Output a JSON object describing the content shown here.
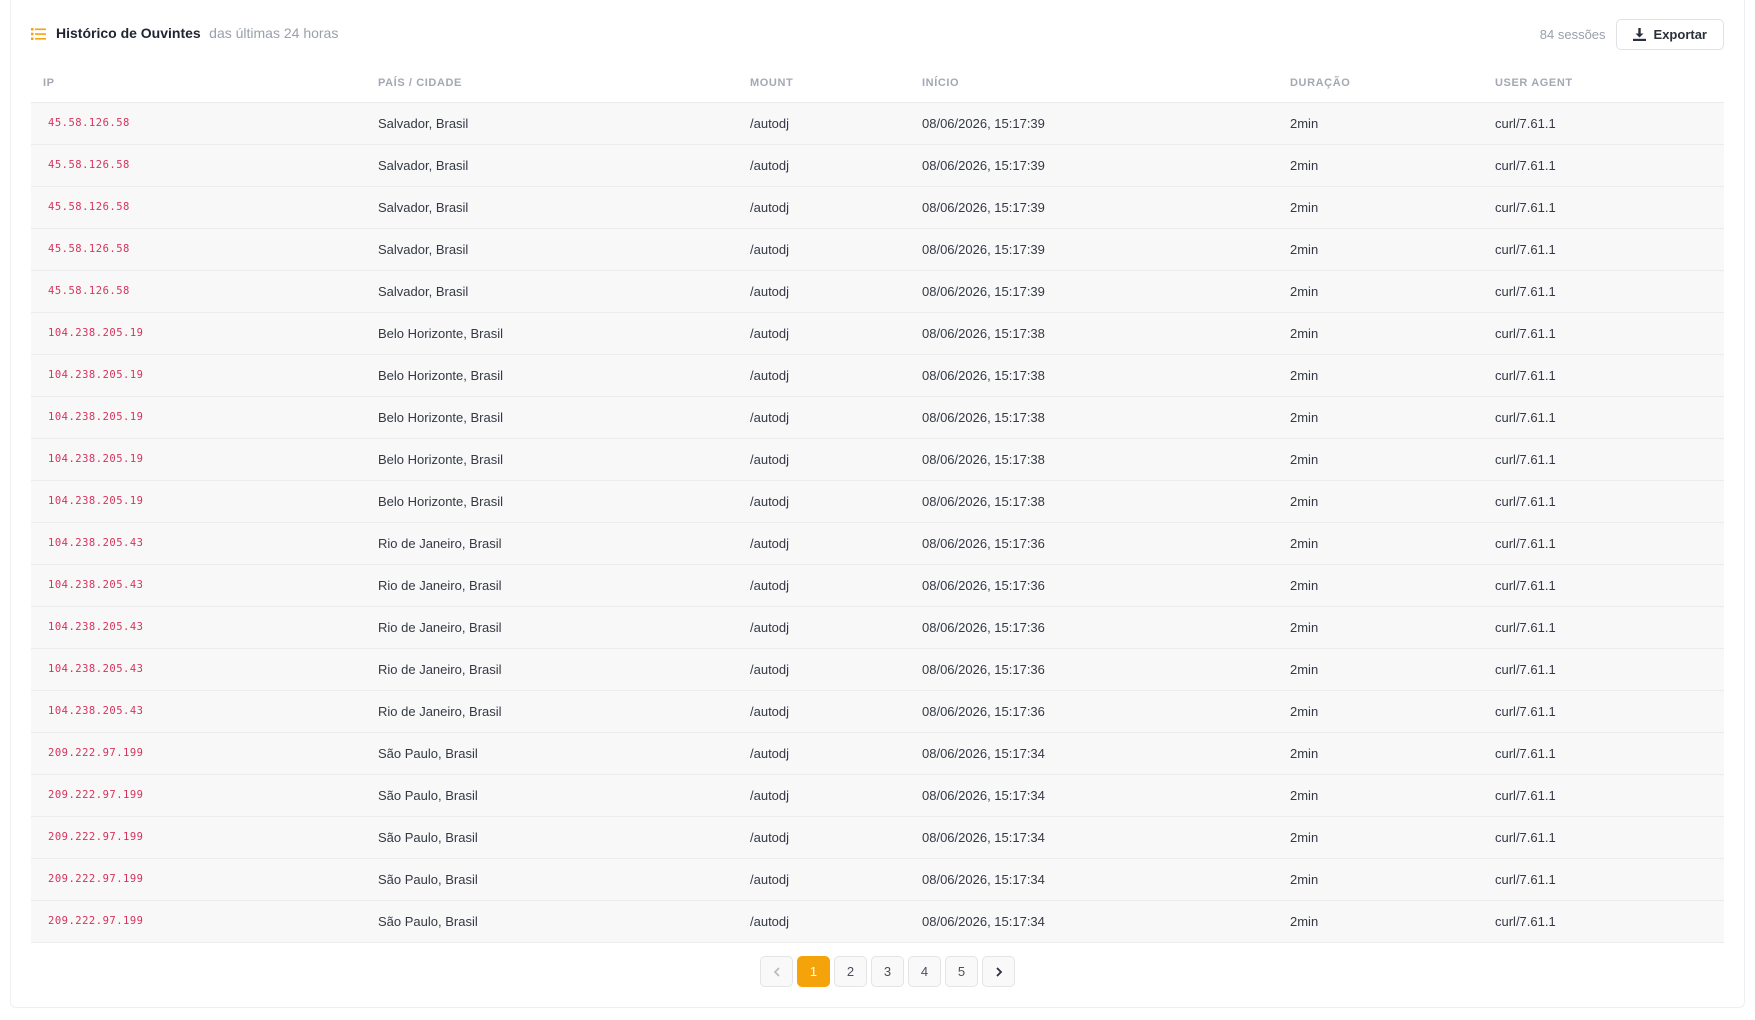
{
  "header": {
    "title": "Histórico de Ouvintes",
    "subtitle": "das últimas 24 horas",
    "count": "84 sessões",
    "export_label": "Exportar"
  },
  "colors": {
    "accent": "#f5a30a",
    "ip_text": "#d6335c"
  },
  "table": {
    "columns": [
      "IP",
      "PAÍS / CIDADE",
      "MOUNT",
      "INÍCIO",
      "DURAÇÃO",
      "USER AGENT"
    ],
    "rows": [
      [
        "45.58.126.58",
        "Salvador, Brasil",
        "/autodj",
        "08/06/2026, 15:17:39",
        "2min",
        "curl/7.61.1"
      ],
      [
        "45.58.126.58",
        "Salvador, Brasil",
        "/autodj",
        "08/06/2026, 15:17:39",
        "2min",
        "curl/7.61.1"
      ],
      [
        "45.58.126.58",
        "Salvador, Brasil",
        "/autodj",
        "08/06/2026, 15:17:39",
        "2min",
        "curl/7.61.1"
      ],
      [
        "45.58.126.58",
        "Salvador, Brasil",
        "/autodj",
        "08/06/2026, 15:17:39",
        "2min",
        "curl/7.61.1"
      ],
      [
        "45.58.126.58",
        "Salvador, Brasil",
        "/autodj",
        "08/06/2026, 15:17:39",
        "2min",
        "curl/7.61.1"
      ],
      [
        "104.238.205.19",
        "Belo Horizonte, Brasil",
        "/autodj",
        "08/06/2026, 15:17:38",
        "2min",
        "curl/7.61.1"
      ],
      [
        "104.238.205.19",
        "Belo Horizonte, Brasil",
        "/autodj",
        "08/06/2026, 15:17:38",
        "2min",
        "curl/7.61.1"
      ],
      [
        "104.238.205.19",
        "Belo Horizonte, Brasil",
        "/autodj",
        "08/06/2026, 15:17:38",
        "2min",
        "curl/7.61.1"
      ],
      [
        "104.238.205.19",
        "Belo Horizonte, Brasil",
        "/autodj",
        "08/06/2026, 15:17:38",
        "2min",
        "curl/7.61.1"
      ],
      [
        "104.238.205.19",
        "Belo Horizonte, Brasil",
        "/autodj",
        "08/06/2026, 15:17:38",
        "2min",
        "curl/7.61.1"
      ],
      [
        "104.238.205.43",
        "Rio de Janeiro, Brasil",
        "/autodj",
        "08/06/2026, 15:17:36",
        "2min",
        "curl/7.61.1"
      ],
      [
        "104.238.205.43",
        "Rio de Janeiro, Brasil",
        "/autodj",
        "08/06/2026, 15:17:36",
        "2min",
        "curl/7.61.1"
      ],
      [
        "104.238.205.43",
        "Rio de Janeiro, Brasil",
        "/autodj",
        "08/06/2026, 15:17:36",
        "2min",
        "curl/7.61.1"
      ],
      [
        "104.238.205.43",
        "Rio de Janeiro, Brasil",
        "/autodj",
        "08/06/2026, 15:17:36",
        "2min",
        "curl/7.61.1"
      ],
      [
        "104.238.205.43",
        "Rio de Janeiro, Brasil",
        "/autodj",
        "08/06/2026, 15:17:36",
        "2min",
        "curl/7.61.1"
      ],
      [
        "209.222.97.199",
        "São Paulo, Brasil",
        "/autodj",
        "08/06/2026, 15:17:34",
        "2min",
        "curl/7.61.1"
      ],
      [
        "209.222.97.199",
        "São Paulo, Brasil",
        "/autodj",
        "08/06/2026, 15:17:34",
        "2min",
        "curl/7.61.1"
      ],
      [
        "209.222.97.199",
        "São Paulo, Brasil",
        "/autodj",
        "08/06/2026, 15:17:34",
        "2min",
        "curl/7.61.1"
      ],
      [
        "209.222.97.199",
        "São Paulo, Brasil",
        "/autodj",
        "08/06/2026, 15:17:34",
        "2min",
        "curl/7.61.1"
      ],
      [
        "209.222.97.199",
        "São Paulo, Brasil",
        "/autodj",
        "08/06/2026, 15:17:34",
        "2min",
        "curl/7.61.1"
      ]
    ]
  },
  "pagination": {
    "pages": [
      "1",
      "2",
      "3",
      "4",
      "5"
    ],
    "current": "1",
    "prev_icon": "chevron-left-icon",
    "next_icon": "chevron-right-icon"
  }
}
